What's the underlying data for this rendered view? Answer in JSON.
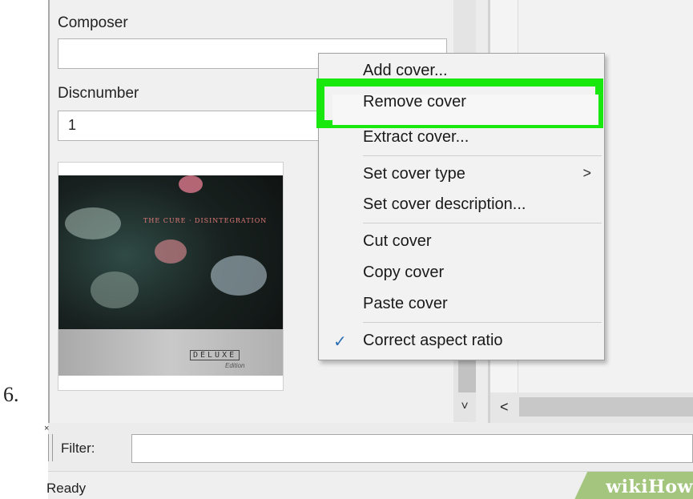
{
  "step_number": "6.",
  "fields": {
    "composer_label": "Composer",
    "composer_value": "",
    "discnumber_label": "Discnumber",
    "discnumber_value": "1"
  },
  "cover": {
    "title_text": "THE CURE · DISINTEGRATION",
    "deluxe_text": "DELUXE",
    "edition_text": "Edition"
  },
  "context_menu": {
    "items": [
      {
        "label": "Add cover..."
      },
      {
        "label": "Remove cover"
      },
      {
        "label": "Extract cover..."
      },
      {
        "label": "Set cover type",
        "submenu_arrow": ">"
      },
      {
        "label": "Set cover description..."
      },
      {
        "label": "Cut cover"
      },
      {
        "label": "Copy cover"
      },
      {
        "label": "Paste cover"
      },
      {
        "label": "Correct aspect ratio",
        "checked": true,
        "check_glyph": "✓"
      }
    ],
    "highlighted_item": "Remove cover",
    "highlight_color": "#19e80f"
  },
  "scrollbar": {
    "down_arrow": "˅",
    "left_arrow": "<"
  },
  "filter": {
    "close_glyph": "×",
    "label": "Filter:",
    "value": ""
  },
  "status_bar": {
    "text": "Ready"
  },
  "watermark": {
    "text": "wikiHow",
    "color": "#a3c57d"
  }
}
